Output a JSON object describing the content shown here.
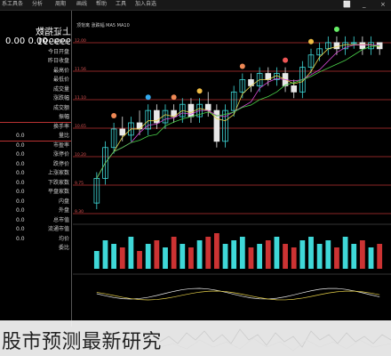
{
  "menu": [
    "系工具条",
    "分析",
    "周期",
    "画线",
    "帮助",
    "工具",
    "加入自选"
  ],
  "window_controls": [
    "⬜",
    "_",
    "×"
  ],
  "left_panel": {
    "title": "上证指数",
    "code": "999991",
    "price_label": "0.00",
    "price_value": "0.00",
    "rows": [
      {
        "value": "",
        "label": "最新价"
      },
      {
        "value": "",
        "label": "今日开盘"
      },
      {
        "value": "",
        "label": "昨日收盘"
      },
      {
        "value": "",
        "label": "最高价"
      },
      {
        "value": "",
        "label": "最低价"
      },
      {
        "value": "",
        "label": "成交量"
      },
      {
        "value": "",
        "label": "涨跌幅"
      },
      {
        "value": "",
        "label": "成交额"
      },
      {
        "value": "",
        "label": "振幅"
      },
      {
        "value": "",
        "label": "换手率"
      },
      {
        "value": "0.0",
        "label": "量比"
      },
      {
        "value": "0.0",
        "label": "市盈率"
      },
      {
        "value": "0.0",
        "label": "涨停价"
      },
      {
        "value": "0.0",
        "label": "跌停价"
      },
      {
        "value": "0.0",
        "label": "上涨家数"
      },
      {
        "value": "0.0",
        "label": "下跌家数"
      },
      {
        "value": "0.0",
        "label": "平盘家数"
      },
      {
        "value": "0.0",
        "label": "内盘"
      },
      {
        "value": "0.0",
        "label": "外盘"
      },
      {
        "value": "0.0",
        "label": "总市值"
      },
      {
        "value": "0.0",
        "label": "流通市值"
      },
      {
        "value": "0.0",
        "label": "均价"
      },
      {
        "value": "",
        "label": "委比"
      }
    ]
  },
  "chart_header": "顶背离 涨跌幅 MA5 MA10",
  "level_labels": [
    "12.00",
    "11.56",
    "11.10",
    "10.65",
    "10.20",
    "9.75",
    "9.30"
  ],
  "colors": {
    "up": "#3fd8d8",
    "down": "#e8e8e8",
    "ma_yellow": "#e8d24a",
    "ma_purple": "#d24ad2",
    "ma_green": "#4ad24a",
    "level": "#b33"
  },
  "chart_data": {
    "type": "candlestick",
    "candles": [
      [
        0,
        9.4,
        9.8,
        9.3,
        9.9
      ],
      [
        1,
        9.8,
        10.3,
        9.7,
        10.4
      ],
      [
        2,
        10.3,
        10.6,
        10.2,
        10.7
      ],
      [
        3,
        10.6,
        10.5,
        10.4,
        10.8
      ],
      [
        4,
        10.5,
        10.7,
        10.4,
        10.8
      ],
      [
        5,
        10.7,
        10.6,
        10.5,
        10.9
      ],
      [
        6,
        10.6,
        10.9,
        10.5,
        11.0
      ],
      [
        7,
        10.9,
        10.7,
        10.6,
        11.0
      ],
      [
        8,
        10.7,
        10.9,
        10.6,
        11.0
      ],
      [
        9,
        10.9,
        10.8,
        10.7,
        11.0
      ],
      [
        10,
        10.8,
        11.0,
        10.7,
        11.1
      ],
      [
        11,
        11.0,
        10.8,
        10.7,
        11.1
      ],
      [
        12,
        10.8,
        11.0,
        10.7,
        11.1
      ],
      [
        13,
        11.0,
        10.9,
        10.8,
        11.2
      ],
      [
        14,
        10.9,
        10.4,
        10.3,
        11.0
      ],
      [
        15,
        10.4,
        10.9,
        10.3,
        11.0
      ],
      [
        16,
        10.9,
        11.2,
        10.8,
        11.3
      ],
      [
        17,
        11.2,
        11.4,
        11.1,
        11.5
      ],
      [
        18,
        11.4,
        11.3,
        11.2,
        11.5
      ],
      [
        19,
        11.3,
        11.5,
        11.2,
        11.6
      ],
      [
        20,
        11.5,
        11.4,
        11.3,
        11.6
      ],
      [
        21,
        11.4,
        11.5,
        11.3,
        11.6
      ],
      [
        22,
        11.5,
        11.3,
        11.2,
        11.6
      ],
      [
        23,
        11.3,
        11.2,
        11.1,
        11.4
      ],
      [
        24,
        11.2,
        11.6,
        11.1,
        11.7
      ],
      [
        25,
        11.6,
        11.8,
        11.5,
        11.9
      ],
      [
        26,
        11.8,
        11.9,
        11.7,
        12.0
      ],
      [
        27,
        11.9,
        12.0,
        11.8,
        12.1
      ],
      [
        28,
        12.0,
        11.9,
        11.8,
        12.1
      ],
      [
        29,
        11.9,
        12.0,
        11.8,
        12.1
      ],
      [
        30,
        12.0,
        12.0,
        11.9,
        12.1
      ],
      [
        31,
        12.0,
        11.9,
        11.8,
        12.1
      ],
      [
        32,
        11.9,
        12.0,
        11.8,
        12.1
      ],
      [
        33,
        12.0,
        11.9,
        11.8,
        12.0
      ]
    ],
    "volumes": [
      5,
      8,
      7,
      6,
      9,
      5,
      7,
      8,
      6,
      9,
      7,
      6,
      8,
      9,
      10,
      7,
      8,
      9,
      6,
      7,
      8,
      9,
      7,
      6,
      8,
      9,
      7,
      8,
      6,
      9,
      7,
      8,
      6,
      7
    ],
    "ylim": [
      9.2,
      12.2
    ]
  }
}
